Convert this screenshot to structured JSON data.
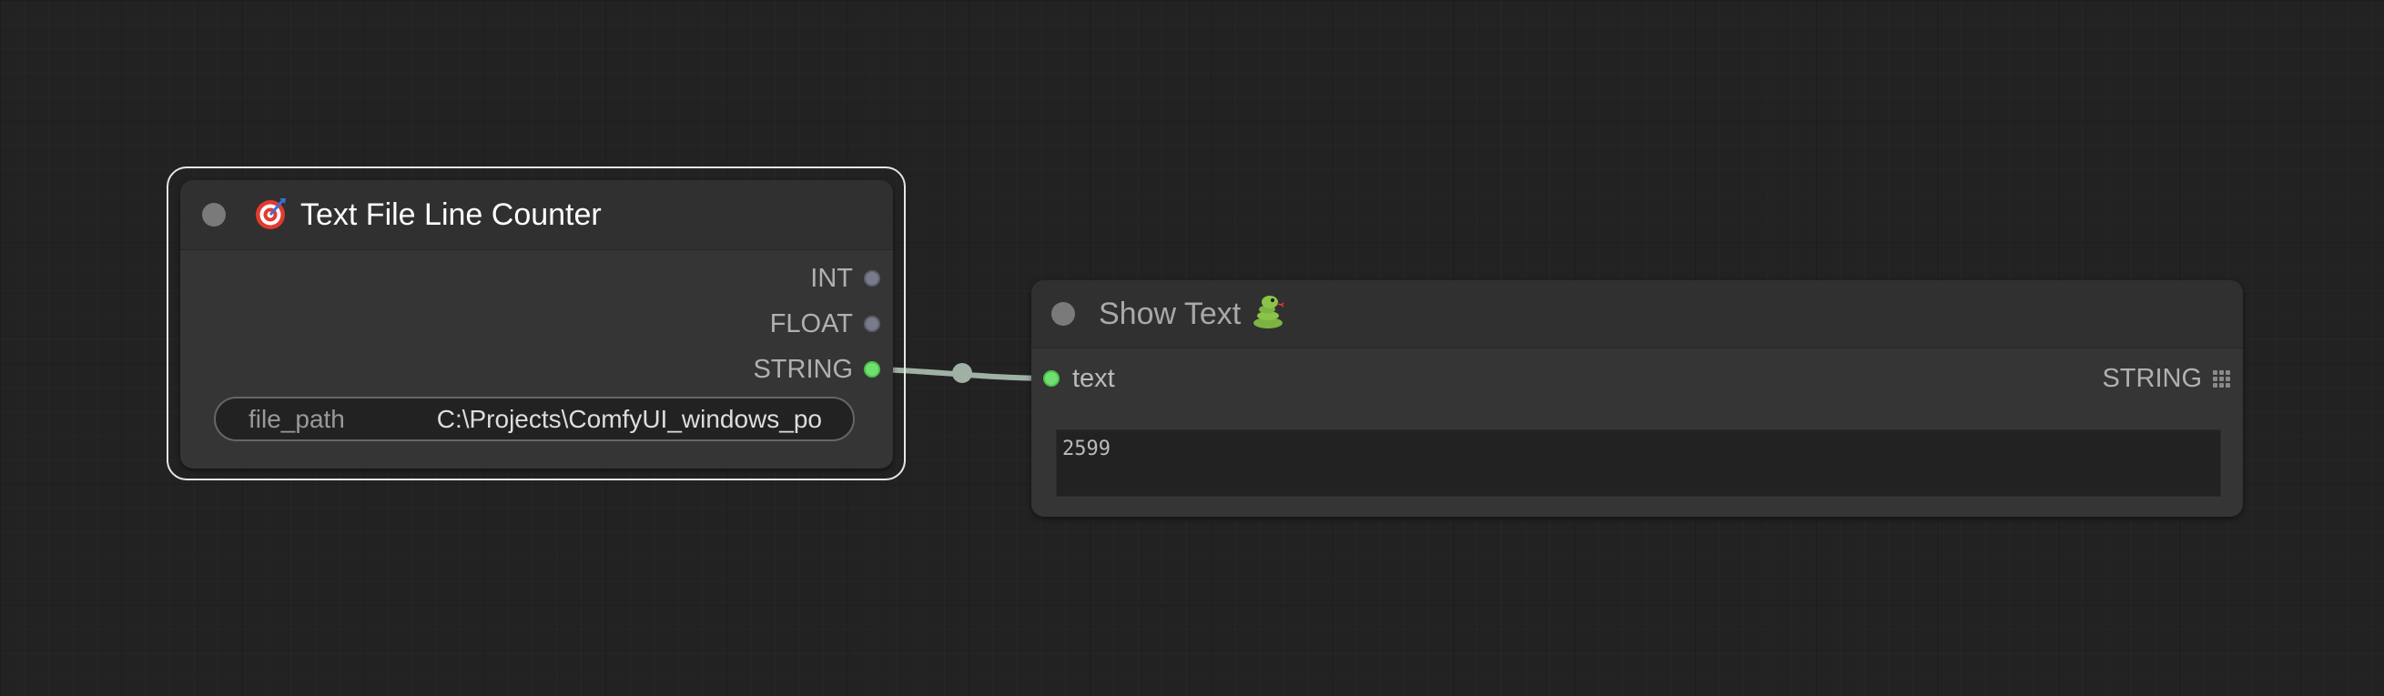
{
  "nodes": {
    "counter": {
      "title": "Text File Line Counter",
      "title_icon": "target-icon",
      "outputs": [
        {
          "label": "INT",
          "connected": false
        },
        {
          "label": "FLOAT",
          "connected": false
        },
        {
          "label": "STRING",
          "connected": true
        }
      ],
      "widget": {
        "label": "file_path",
        "value": "C:\\Projects\\ComfyUI_windows_po"
      }
    },
    "show_text": {
      "title": "Show Text",
      "title_icon": "snake-icon",
      "input": {
        "label": "text",
        "connected": true
      },
      "output": {
        "label": "STRING",
        "icon": "grid-icon"
      },
      "text_value": "2599"
    }
  },
  "colors": {
    "canvas_background": "#222222",
    "node_body": "#353535",
    "node_header": "#303030",
    "connected_slot": "#6fe06f",
    "unconnected_slot": "#777b8a",
    "link_color": "#9fb1a4",
    "selection_outline": "#e6e6e6"
  }
}
